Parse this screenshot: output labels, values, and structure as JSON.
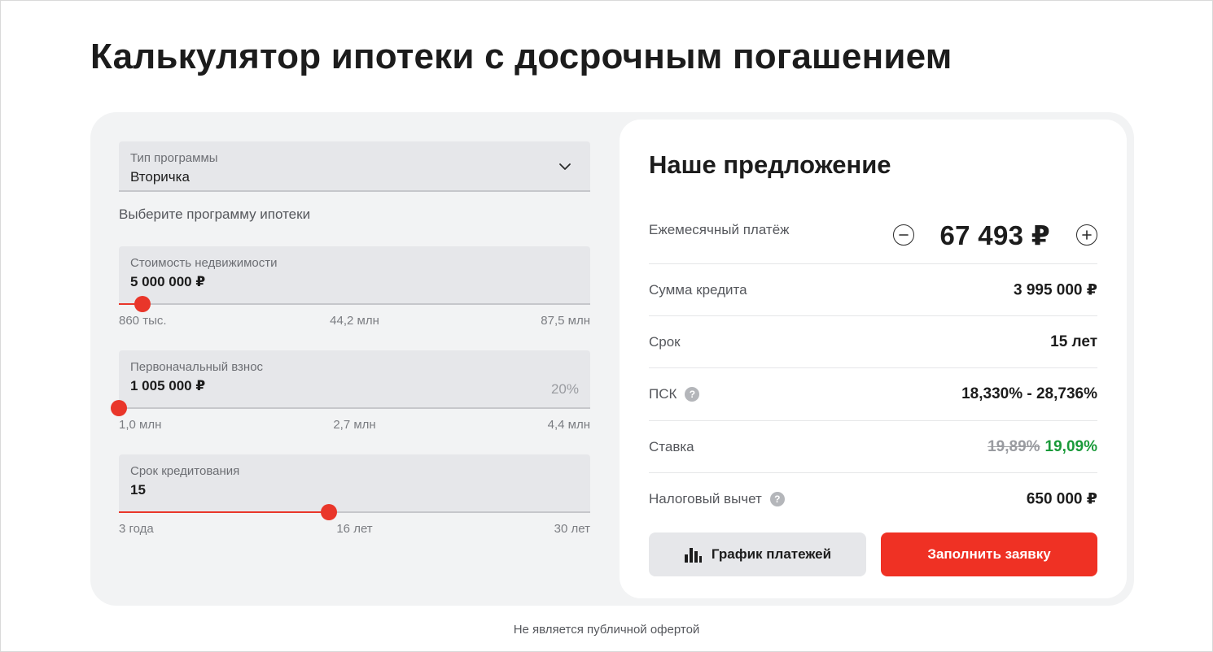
{
  "page": {
    "title": "Калькулятор ипотеки с досрочным погашением"
  },
  "program": {
    "label": "Тип программы",
    "value": "Вторичка",
    "helper": "Выберите программу ипотеки"
  },
  "property_cost": {
    "label": "Стоимость недвижимости",
    "value": "5 000 000 ₽",
    "ticks": [
      "860 тыс.",
      "44,2 млн",
      "87,5 млн"
    ],
    "level": 0.05
  },
  "down_payment": {
    "label": "Первоначальный взнос",
    "value": "1 005 000 ₽",
    "percent": "20%",
    "ticks": [
      "1,0 млн",
      "2,7 млн",
      "4,4 млн"
    ],
    "level": 0.0
  },
  "term": {
    "label": "Срок кредитования",
    "value": "15",
    "ticks": [
      "3 года",
      "16 лет",
      "30 лет"
    ],
    "level": 0.445
  },
  "offer": {
    "title": "Наше предложение",
    "monthly_label": "Ежемесячный платёж",
    "monthly_value": "67 493 ₽",
    "loan_label": "Сумма кредита",
    "loan_value": "3 995 000 ₽",
    "term_label": "Срок",
    "term_value": "15 лет",
    "psk_label": "ПСК",
    "psk_value": "18,330% - 28,736%",
    "rate_label": "Ставка",
    "rate_old": "19,89%",
    "rate_new": "19,09%",
    "tax_label": "Налоговый вычет",
    "tax_value": "650 000 ₽",
    "help_glyph": "?"
  },
  "buttons": {
    "schedule": "График платежей",
    "apply": "Заполнить заявку"
  },
  "disclaimer": "Не является публичной офертой",
  "colors": {
    "accent": "#ef3124",
    "rate_green": "#1a9a3a",
    "card_bg": "#f2f3f4",
    "field_bg": "#e6e7ea"
  },
  "icons": {
    "dropdown": "chevron-down-icon",
    "decrease": "minus-circle-icon",
    "increase": "plus-circle-icon",
    "help": "question-icon",
    "schedule": "bar-chart-icon"
  }
}
